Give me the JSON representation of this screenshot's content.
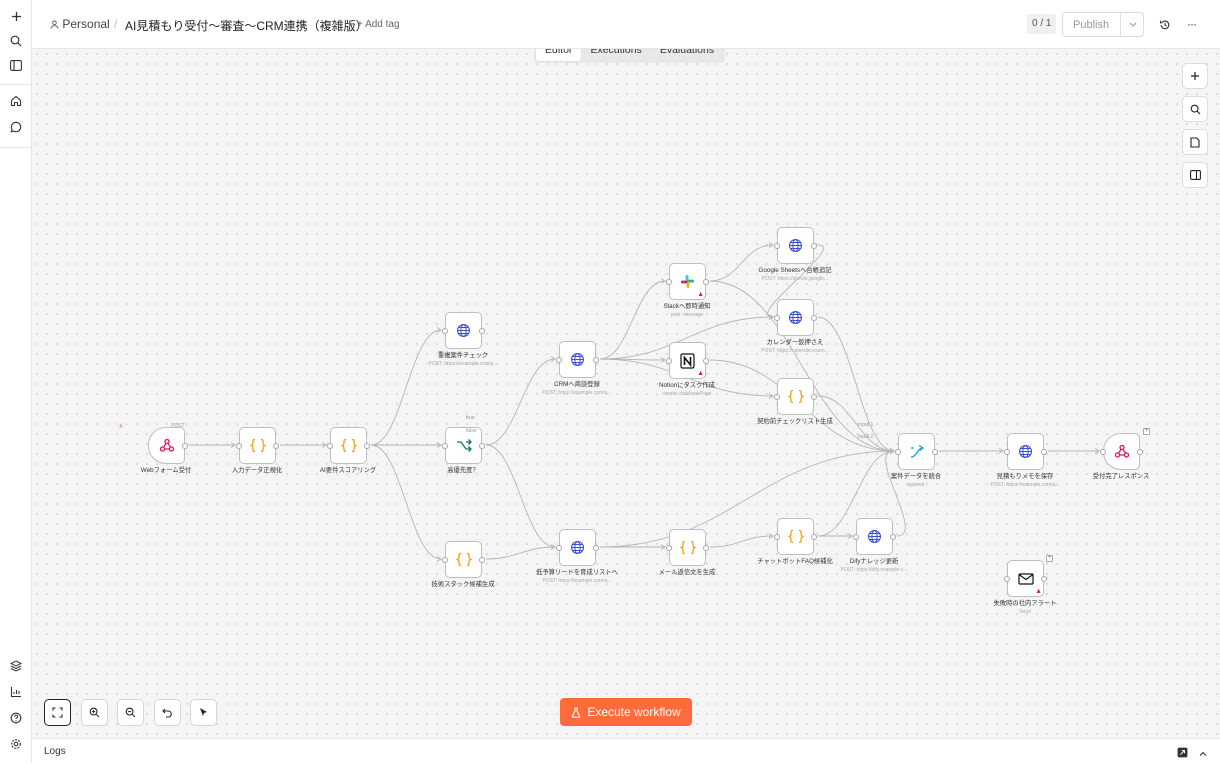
{
  "breadcrumb": {
    "owner": "Personal",
    "separator": "/",
    "title": "AI見積もり受付〜審査〜CRM連携（複雑版）",
    "add_tag": "+ Add tag"
  },
  "header": {
    "counter": "0 / 1",
    "publish": "Publish"
  },
  "tabs": [
    "Editor",
    "Executions",
    "Evaluations"
  ],
  "nodes": [
    {
      "label": "Webフォーム受付",
      "sub": "",
      "icon": "webhook-icon",
      "color": "#e0115f"
    },
    {
      "label": "入力データ正規化",
      "sub": "",
      "icon": "code-braces-icon",
      "color": "#f59e0b"
    },
    {
      "label": "AI要件スコアリング",
      "sub": "",
      "icon": "code-braces-icon",
      "color": "#f59e0b"
    },
    {
      "label": "重複案件チェック",
      "sub": "POST: https://example.com/a...",
      "icon": "globe-icon",
      "color": "#3b4fd1"
    },
    {
      "label": "高優先度？",
      "sub": "",
      "icon": "switch-icon",
      "color": "#0f766e"
    },
    {
      "label": "技術スタック候補生成",
      "sub": "",
      "icon": "code-braces-icon",
      "color": "#f59e0b"
    },
    {
      "label": "CRMへ商談登録",
      "sub": "POST: https://example.com/a...",
      "icon": "globe-icon",
      "color": "#3b4fd1"
    },
    {
      "label": "低予算リードを育成リストへ",
      "sub": "POST: https://example.com/a...",
      "icon": "globe-icon",
      "color": "#3b4fd1"
    },
    {
      "label": "Slackへ即時通知",
      "sub": "post: message",
      "icon": "slack-icon",
      "color": "#4a154b"
    },
    {
      "label": "Notionにタスク作成",
      "sub": "create: databasePage",
      "icon": "notion-icon",
      "color": "#111"
    },
    {
      "label": "メール返信文を生成",
      "sub": "",
      "icon": "code-braces-icon",
      "color": "#f59e0b"
    },
    {
      "label": "Google Sheetsへ台帳追記",
      "sub": "POST: https://sheets.google...",
      "icon": "globe-icon",
      "color": "#3b4fd1"
    },
    {
      "label": "カレンダー仮押さえ",
      "sub": "POST: https://calendar.exam...",
      "icon": "globe-icon",
      "color": "#3b4fd1"
    },
    {
      "label": "契約前チェックリスト生成",
      "sub": "",
      "icon": "code-braces-icon",
      "color": "#f59e0b"
    },
    {
      "label": "チャットボットFAQ候補化",
      "sub": "",
      "icon": "code-braces-icon",
      "color": "#f59e0b"
    },
    {
      "label": "Difyナレッジ更新",
      "sub": "POST: https://dify.example.c...",
      "icon": "globe-icon",
      "color": "#3b4fd1"
    },
    {
      "label": "案件データを統合",
      "sub": "append",
      "icon": "merge-icon",
      "color": "#0ea5e9"
    },
    {
      "label": "見積もりメモを保存",
      "sub": "POST: https://example.com/a...",
      "icon": "globe-icon",
      "color": "#3b4fd1"
    },
    {
      "label": "受付完了レスポンス",
      "sub": "",
      "icon": "webhook-icon",
      "color": "#e0115f"
    },
    {
      "label": "失敗時の社内アラート",
      "sub": "Send",
      "icon": "mail-icon",
      "color": "#111"
    }
  ],
  "edge_labels": {
    "post": "POST",
    "true": "true",
    "false": "false",
    "input1": "Input 1",
    "input2": "Input 2"
  },
  "execute": "Execute workflow",
  "logs": "Logs"
}
